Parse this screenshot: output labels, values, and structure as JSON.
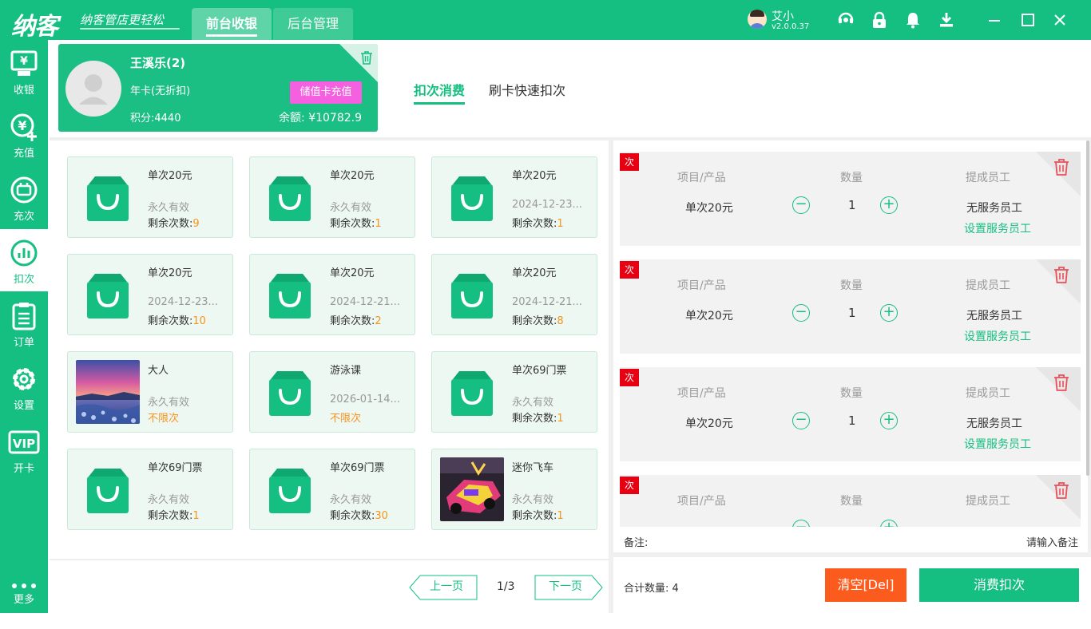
{
  "app": {
    "logo": "纳客",
    "slogan": "纳客管店更轻松",
    "version": "v2.0.0.37",
    "user": "艾小"
  },
  "tabs": [
    {
      "label": "前台收银"
    },
    {
      "label": "后台管理"
    }
  ],
  "sidebar": [
    {
      "label": "收银"
    },
    {
      "label": "充值"
    },
    {
      "label": "充次"
    },
    {
      "label": "扣次"
    },
    {
      "label": "订单"
    },
    {
      "label": "设置"
    },
    {
      "label": "开卡"
    },
    {
      "label": "更多"
    }
  ],
  "member": {
    "name": "王溪乐(2)",
    "card_type": "年卡(无折扣)",
    "points": "积分:4440",
    "balance": "余额: ¥10782.9",
    "recharge_button": "储值卡充值"
  },
  "content_tabs": [
    {
      "label": "扣次消费"
    },
    {
      "label": "刷卡快速扣次"
    }
  ],
  "remain_label": "剩余次数:",
  "products": [
    {
      "title": "单次20元",
      "validity": "永久有效",
      "remain": "9",
      "image": "bag"
    },
    {
      "title": "单次20元",
      "validity": "永久有效",
      "remain": "1",
      "image": "bag"
    },
    {
      "title": "单次20元",
      "validity": "2024-12-23...",
      "remain": "1",
      "image": "bag"
    },
    {
      "title": "单次20元",
      "validity": "2024-12-23...",
      "remain": "10",
      "image": "bag"
    },
    {
      "title": "单次20元",
      "validity": "2024-12-21...",
      "remain": "2",
      "image": "bag"
    },
    {
      "title": "单次20元",
      "validity": "2024-12-21...",
      "remain": "8",
      "image": "bag"
    },
    {
      "title": "大人",
      "validity": "永久有效",
      "unlimited": "不限次",
      "image": "photo-sunset"
    },
    {
      "title": "游泳课",
      "validity": "2026-01-14...",
      "unlimited": "不限次",
      "image": "bag"
    },
    {
      "title": "单次69门票",
      "validity": "永久有效",
      "remain": "1",
      "image": "bag"
    },
    {
      "title": "单次69门票",
      "validity": "永久有效",
      "remain": "1",
      "image": "bag"
    },
    {
      "title": "单次69门票",
      "validity": "永久有效",
      "remain": "30",
      "image": "bag"
    },
    {
      "title": "迷你飞车",
      "validity": "永久有效",
      "remain": "1",
      "image": "photo-kart"
    }
  ],
  "pager": {
    "prev": "上一页",
    "page": "1/3",
    "next": "下一页"
  },
  "cart": {
    "headers": {
      "item": "项目/产品",
      "qty": "数量",
      "staff": "提成员工"
    },
    "tag": "次",
    "items": [
      {
        "name": "单次20元",
        "qty": "1",
        "staff": "无服务员工",
        "set_staff": "设置服务员工"
      },
      {
        "name": "单次20元",
        "qty": "1",
        "staff": "无服务员工",
        "set_staff": "设置服务员工"
      },
      {
        "name": "单次20元",
        "qty": "1",
        "staff": "无服务员工",
        "set_staff": "设置服务员工"
      },
      {
        "name": "",
        "qty": "",
        "staff": "",
        "set_staff": ""
      }
    ],
    "remark_label": "备注:",
    "remark_placeholder": "请输入备注",
    "total": "合计数量:  4",
    "clear_button": "清空[Del]",
    "pay_button": "消费扣次"
  },
  "colors": {
    "brand": "#15bf81",
    "orange": "#f7931e",
    "clear": "#fb5b1d",
    "pink": "#f560e0",
    "tag": "#e60012"
  }
}
